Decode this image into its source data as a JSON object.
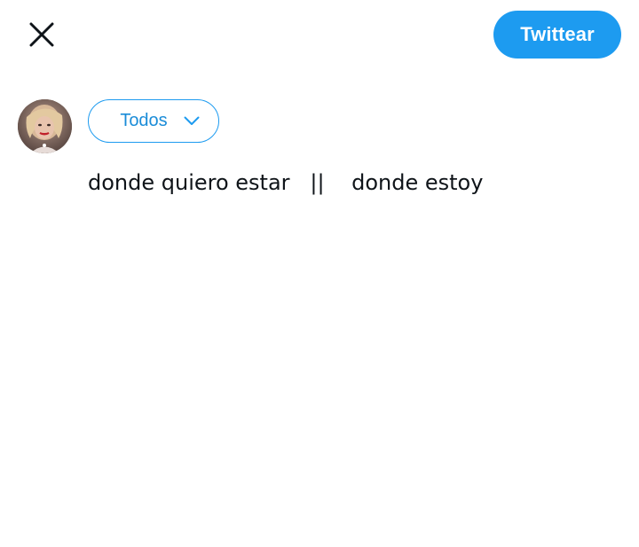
{
  "header": {
    "close_icon": "close-icon",
    "tweet_button_label": "Twittear"
  },
  "composer": {
    "avatar": "user-avatar",
    "audience": {
      "label": "Todos",
      "icon": "chevron-down-icon"
    },
    "text": "donde quiero estar   ||    donde estoy"
  },
  "colors": {
    "accent": "#1d9bf0",
    "text": "#0f1419",
    "background": "#ffffff"
  }
}
